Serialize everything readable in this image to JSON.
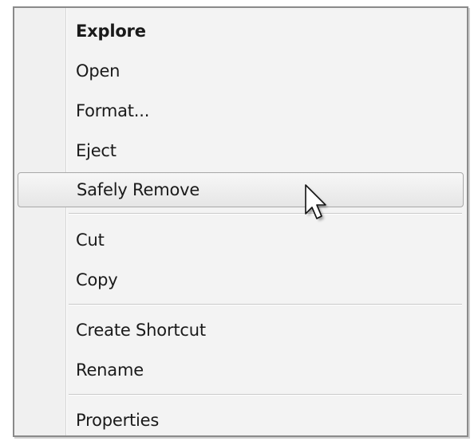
{
  "context_menu": {
    "items": [
      {
        "label": "Explore"
      },
      {
        "label": "Open"
      },
      {
        "label": "Format..."
      },
      {
        "label": "Eject"
      },
      {
        "label": "Safely Remove"
      },
      {
        "label": "Cut"
      },
      {
        "label": "Copy"
      },
      {
        "label": "Create Shortcut"
      },
      {
        "label": "Rename"
      },
      {
        "label": "Properties"
      }
    ],
    "default_item": "Explore",
    "hovered_item": "Safely Remove"
  },
  "cursor": {
    "icon": "arrow-pointer-icon"
  }
}
